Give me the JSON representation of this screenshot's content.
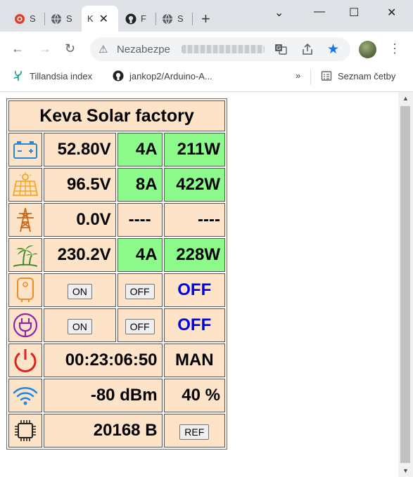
{
  "tabs": [
    {
      "label": "S",
      "icon": "red-circle-favicon"
    },
    {
      "label": "S",
      "icon": "globe-favicon"
    },
    {
      "label": "K",
      "icon": "none",
      "active": true
    },
    {
      "label": "F",
      "icon": "github-favicon"
    },
    {
      "label": "S",
      "icon": "globe-favicon"
    }
  ],
  "window": {
    "minimize": "—",
    "maximize": "☐",
    "close": "✕"
  },
  "omnibox": {
    "security_label": "Nezabezpe",
    "url_obscured": true
  },
  "bookmarks": [
    {
      "label": "Tillandsia index",
      "icon": "plant-icon"
    },
    {
      "label": "jankop2/Arduino-A...",
      "icon": "github-icon"
    }
  ],
  "bookmarks_more": "»",
  "reading_list": "Seznam četby",
  "solar": {
    "title": "Keva Solar factory",
    "battery": {
      "voltage": "52.80V",
      "current": "4A",
      "power": "211W"
    },
    "pv": {
      "voltage": "96.5V",
      "current": "8A",
      "power": "422W"
    },
    "grid": {
      "voltage": "0.0V",
      "current": "----",
      "power": "----"
    },
    "output": {
      "voltage": "230.2V",
      "current": "4A",
      "power": "228W"
    },
    "heater": {
      "on_label": "ON",
      "off_label": "OFF",
      "state": "OFF"
    },
    "socket": {
      "on_label": "ON",
      "off_label": "OFF",
      "state": "OFF"
    },
    "time": {
      "uptime": "00:23:06:50",
      "mode": "MAN"
    },
    "wifi": {
      "rssi": "-80 dBm",
      "quality": "40 %"
    },
    "memory": {
      "free": "20168 B",
      "ref_label": "REF"
    }
  },
  "colors": {
    "cell_bg": "#fde3c8",
    "green": "#8cfb8c",
    "state_blue": "#0000e6"
  }
}
